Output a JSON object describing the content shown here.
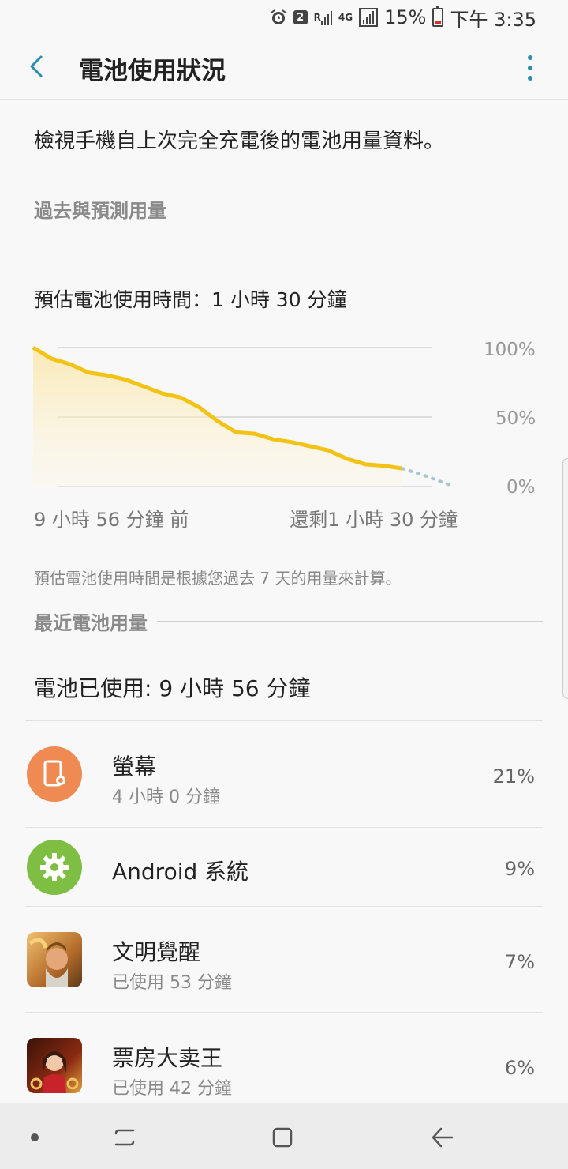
{
  "status_bar": {
    "badge": "2",
    "signal_label": "R",
    "network": "4G",
    "battery_percent": "15%",
    "time": "下午 3:35"
  },
  "header": {
    "title": "電池使用狀況"
  },
  "intro_text": "檢視手機自上次完全充電後的電池用量資料。",
  "section_past": "過去與預測用量",
  "estimate_label": "預估電池使用時間：1 小時 30 分鐘",
  "chart": {
    "y_labels": [
      "100%",
      "50%",
      "0%"
    ],
    "x_left": "9 小時 56 分鐘 前",
    "x_right": "還剩1 小時 30 分鐘",
    "line_color": "#f2c314",
    "predicted_color": "#a9c6cc"
  },
  "chart_data": {
    "type": "line",
    "ylim": [
      0,
      100
    ],
    "series": [
      {
        "x": [
          0,
          0.05,
          0.1,
          0.15,
          0.2,
          0.25,
          0.3,
          0.35,
          0.4,
          0.45,
          0.5,
          0.55,
          0.6,
          0.65,
          0.7,
          0.75,
          0.8,
          0.85,
          0.9,
          0.95,
          1.0
        ],
        "values": [
          100,
          92,
          88,
          82,
          80,
          77,
          72,
          67,
          64,
          57,
          47,
          39,
          38,
          34,
          32,
          29,
          26,
          20,
          16,
          15,
          13
        ]
      },
      {
        "x": [
          1.0,
          1.07,
          1.14
        ],
        "values": [
          13,
          7,
          0
        ]
      }
    ]
  },
  "footnote": "預估電池使用時間是根據您過去 7 天的用量來計算。",
  "section_recent": "最近電池用量",
  "used_total": "電池已使用: 9 小時 56 分鐘",
  "apps": [
    {
      "name": "螢幕",
      "sub": "4 小時 0 分鐘",
      "percent": "21%",
      "icon": "screen-icon",
      "color": "#ee8a52"
    },
    {
      "name": "Android 系統",
      "sub": "",
      "percent": "9%",
      "icon": "gear-icon",
      "color": "#7dbe43"
    },
    {
      "name": "文明覺醒",
      "sub": "已使用 53 分鐘",
      "percent": "7%",
      "icon": "game-avatar-icon",
      "color": "#c98a3f"
    },
    {
      "name": "票房大卖王",
      "sub": "已使用 42 分鐘",
      "percent": "6%",
      "icon": "game-avatar-icon",
      "color": "#7a2a1a"
    }
  ]
}
